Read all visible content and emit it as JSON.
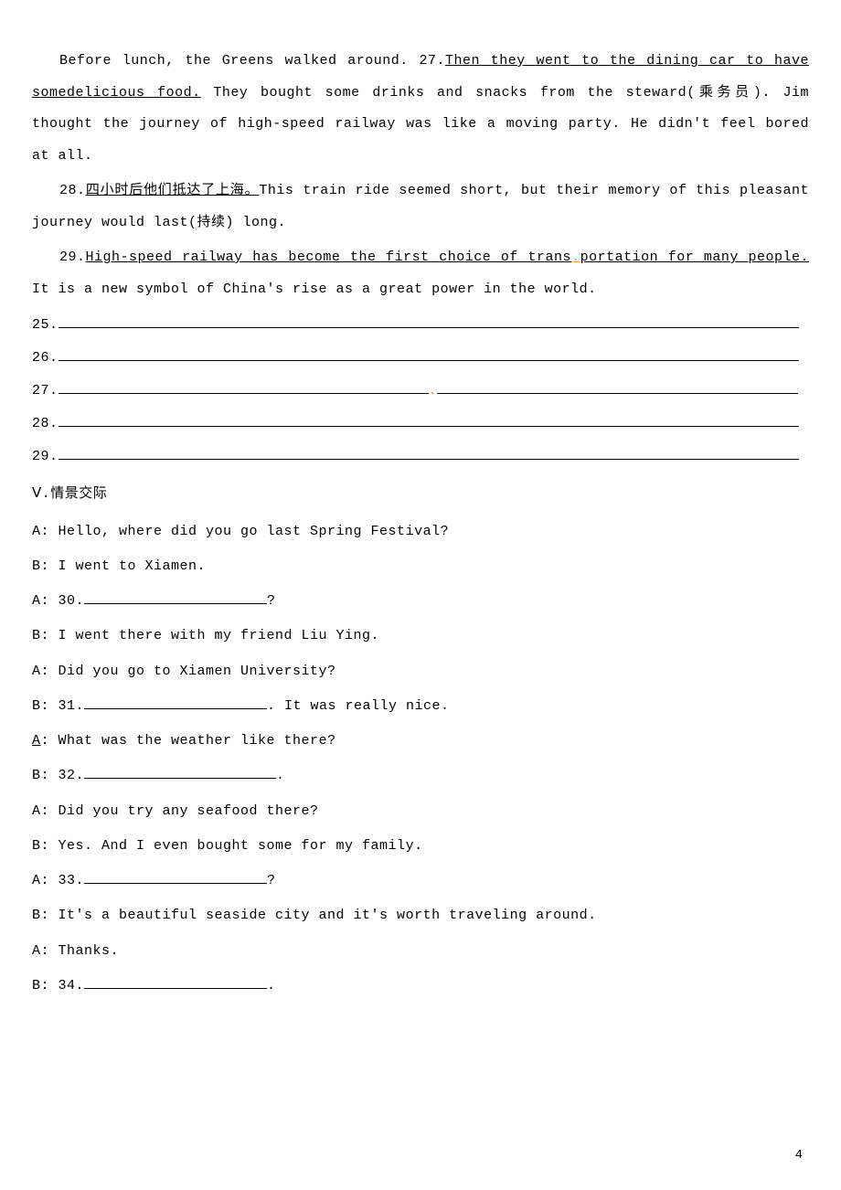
{
  "para1_pre": "Before lunch, the Greens walked around. 27.",
  "para1_u": "Then they went to the dining car to have somedelicious food.",
  "para1_post": " They bought some drinks and snacks from the steward(乘务员). Jim thought the journey of high-speed railway was like a moving party. He didn't feel bored at all.",
  "para2_pre": "28.",
  "para2_u": "四小时后他们抵达了上海。",
  "para2_post": "This train ride seemed short, but their memory of this pleasant journey would last(持续) long.",
  "para3_pre": "29.",
  "para3_u": "High-speed railway has become the first choice of trans",
  "para3_u2": "portation for many people.",
  "para3_post": " It is a new symbol of China's rise as a great power in the world.",
  "answers": {
    "a25": "25.",
    "a26": "26.",
    "a27": "27.",
    "a28": "28.",
    "a29": "29."
  },
  "section5": "Ⅴ.情景交际",
  "dialog": {
    "l1": "A: Hello, where did you go last Spring Festival?",
    "l2": "B: I went to Xiamen.",
    "l3a": "A: 30.",
    "l3b": "?",
    "l4": "B: I went there with my friend Liu Ying.",
    "l5": "A: Did you go to Xiamen University?",
    "l6a": "B: 31.",
    "l6b": ". It was really nice.",
    "l7": "A",
    "l7b": ": What was the weather like there?",
    "l8a": "B: 32.",
    "l8b": ".",
    "l9": "A: Did you try any seafood there?",
    "l10": "B: Yes. And I even bought some for my family.",
    "l11a": "A: 33.",
    "l11b": "?",
    "l12": "B: It's a beautiful seaside city and it's worth traveling around.",
    "l13": "A: Thanks.",
    "l14a": "B: 34.",
    "l14b": "."
  },
  "pagenum": "4"
}
